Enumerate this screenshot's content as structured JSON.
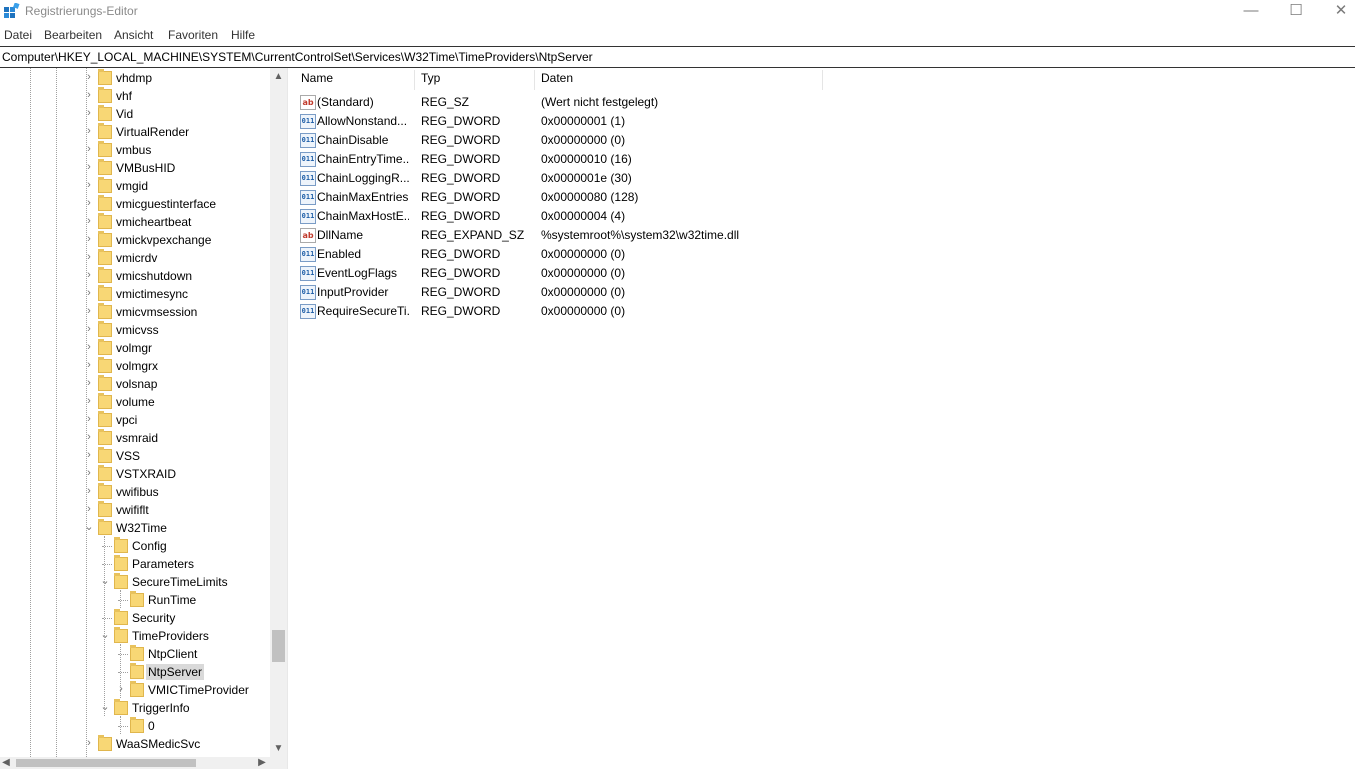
{
  "window": {
    "title": "Registrierungs-Editor",
    "controls": {
      "minimize": "—",
      "maximize": "☐",
      "close": "✕"
    }
  },
  "menu": [
    "Datei",
    "Bearbeiten",
    "Ansicht",
    "Favoriten",
    "Hilfe"
  ],
  "address": "Computer\\HKEY_LOCAL_MACHINE\\SYSTEM\\CurrentControlSet\\Services\\W32Time\\TimeProviders\\NtpServer",
  "tree": [
    {
      "label": "vhdmp",
      "level": 0,
      "expander": "collapsed"
    },
    {
      "label": "vhf",
      "level": 0,
      "expander": "collapsed"
    },
    {
      "label": "Vid",
      "level": 0,
      "expander": "collapsed"
    },
    {
      "label": "VirtualRender",
      "level": 0,
      "expander": "collapsed"
    },
    {
      "label": "vmbus",
      "level": 0,
      "expander": "collapsed"
    },
    {
      "label": "VMBusHID",
      "level": 0,
      "expander": "collapsed"
    },
    {
      "label": "vmgid",
      "level": 0,
      "expander": "collapsed"
    },
    {
      "label": "vmicguestinterface",
      "level": 0,
      "expander": "collapsed"
    },
    {
      "label": "vmicheartbeat",
      "level": 0,
      "expander": "collapsed"
    },
    {
      "label": "vmickvpexchange",
      "level": 0,
      "expander": "collapsed"
    },
    {
      "label": "vmicrdv",
      "level": 0,
      "expander": "collapsed"
    },
    {
      "label": "vmicshutdown",
      "level": 0,
      "expander": "collapsed"
    },
    {
      "label": "vmictimesync",
      "level": 0,
      "expander": "collapsed"
    },
    {
      "label": "vmicvmsession",
      "level": 0,
      "expander": "collapsed"
    },
    {
      "label": "vmicvss",
      "level": 0,
      "expander": "collapsed"
    },
    {
      "label": "volmgr",
      "level": 0,
      "expander": "collapsed"
    },
    {
      "label": "volmgrx",
      "level": 0,
      "expander": "collapsed"
    },
    {
      "label": "volsnap",
      "level": 0,
      "expander": "collapsed"
    },
    {
      "label": "volume",
      "level": 0,
      "expander": "collapsed"
    },
    {
      "label": "vpci",
      "level": 0,
      "expander": "collapsed"
    },
    {
      "label": "vsmraid",
      "level": 0,
      "expander": "collapsed"
    },
    {
      "label": "VSS",
      "level": 0,
      "expander": "collapsed"
    },
    {
      "label": "VSTXRAID",
      "level": 0,
      "expander": "collapsed"
    },
    {
      "label": "vwifibus",
      "level": 0,
      "expander": "collapsed"
    },
    {
      "label": "vwififlt",
      "level": 0,
      "expander": "collapsed"
    },
    {
      "label": "W32Time",
      "level": 0,
      "expander": "expanded"
    },
    {
      "label": "Config",
      "level": 1,
      "expander": "none"
    },
    {
      "label": "Parameters",
      "level": 1,
      "expander": "none"
    },
    {
      "label": "SecureTimeLimits",
      "level": 1,
      "expander": "expanded"
    },
    {
      "label": "RunTime",
      "level": 2,
      "expander": "none"
    },
    {
      "label": "Security",
      "level": 1,
      "expander": "none"
    },
    {
      "label": "TimeProviders",
      "level": 1,
      "expander": "expanded"
    },
    {
      "label": "NtpClient",
      "level": 2,
      "expander": "none"
    },
    {
      "label": "NtpServer",
      "level": 2,
      "expander": "none",
      "selected": true
    },
    {
      "label": "VMICTimeProvider",
      "level": 2,
      "expander": "collapsed"
    },
    {
      "label": "TriggerInfo",
      "level": 1,
      "expander": "expanded"
    },
    {
      "label": "0",
      "level": 2,
      "expander": "none"
    },
    {
      "label": "WaaSMedicSvc",
      "level": 0,
      "expander": "collapsed"
    }
  ],
  "columns": {
    "name": "Name",
    "type": "Typ",
    "data": "Daten"
  },
  "values": [
    {
      "icon": "string-value-icon",
      "icon_glyph": "ab",
      "name": "(Standard)",
      "type": "REG_SZ",
      "data": "(Wert nicht festgelegt)"
    },
    {
      "icon": "binary-value-icon",
      "icon_glyph": "011",
      "name": "AllowNonstand...",
      "type": "REG_DWORD",
      "data": "0x00000001 (1)"
    },
    {
      "icon": "binary-value-icon",
      "icon_glyph": "011",
      "name": "ChainDisable",
      "type": "REG_DWORD",
      "data": "0x00000000 (0)"
    },
    {
      "icon": "binary-value-icon",
      "icon_glyph": "011",
      "name": "ChainEntryTime...",
      "type": "REG_DWORD",
      "data": "0x00000010 (16)"
    },
    {
      "icon": "binary-value-icon",
      "icon_glyph": "011",
      "name": "ChainLoggingR...",
      "type": "REG_DWORD",
      "data": "0x0000001e (30)"
    },
    {
      "icon": "binary-value-icon",
      "icon_glyph": "011",
      "name": "ChainMaxEntries",
      "type": "REG_DWORD",
      "data": "0x00000080 (128)"
    },
    {
      "icon": "binary-value-icon",
      "icon_glyph": "011",
      "name": "ChainMaxHostE...",
      "type": "REG_DWORD",
      "data": "0x00000004 (4)"
    },
    {
      "icon": "string-value-icon",
      "icon_glyph": "ab",
      "name": "DllName",
      "type": "REG_EXPAND_SZ",
      "data": "%systemroot%\\system32\\w32time.dll"
    },
    {
      "icon": "binary-value-icon",
      "icon_glyph": "011",
      "name": "Enabled",
      "type": "REG_DWORD",
      "data": "0x00000000 (0)"
    },
    {
      "icon": "binary-value-icon",
      "icon_glyph": "011",
      "name": "EventLogFlags",
      "type": "REG_DWORD",
      "data": "0x00000000 (0)"
    },
    {
      "icon": "binary-value-icon",
      "icon_glyph": "011",
      "name": "InputProvider",
      "type": "REG_DWORD",
      "data": "0x00000000 (0)"
    },
    {
      "icon": "binary-value-icon",
      "icon_glyph": "011",
      "name": "RequireSecureTi...",
      "type": "REG_DWORD",
      "data": "0x00000000 (0)"
    }
  ],
  "scrollbar_glyphs": {
    "up": "▲",
    "down": "▼",
    "left": "◀",
    "right": "▶"
  },
  "colors": {
    "folder": "#f8d775",
    "selection": "#d9d9d9"
  }
}
